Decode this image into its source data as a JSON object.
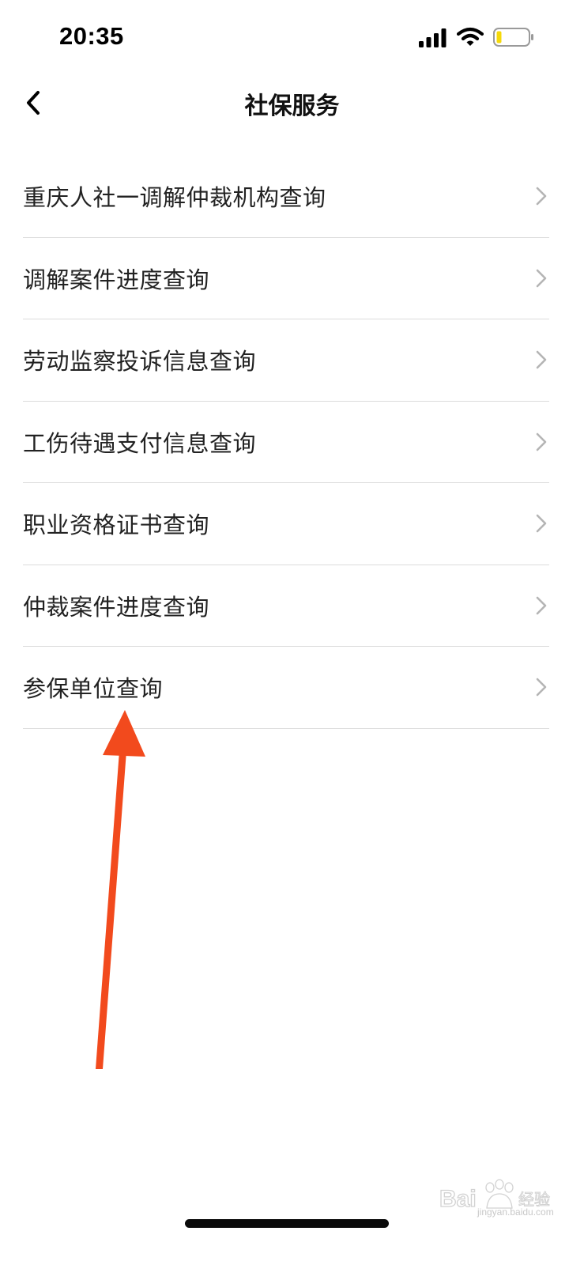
{
  "status_bar": {
    "time": "20:35",
    "battery_color": "#f5d90a"
  },
  "nav": {
    "title": "社保服务",
    "back_icon": "chevron-left-icon"
  },
  "menu": {
    "items": [
      {
        "label": "重庆人社一调解仲裁机构查询"
      },
      {
        "label": "调解案件进度查询"
      },
      {
        "label": "劳动监察投诉信息查询"
      },
      {
        "label": "工伤待遇支付信息查询"
      },
      {
        "label": "职业资格证书查询"
      },
      {
        "label": "仲裁案件进度查询"
      },
      {
        "label": "参保单位查询"
      }
    ],
    "chevron_icon": "chevron-right-icon"
  },
  "annotation": {
    "color": "#f24a1d",
    "target": "参保单位查询"
  },
  "watermark": {
    "brand": "Baidu经验",
    "url": "jingyan.baidu.com"
  }
}
